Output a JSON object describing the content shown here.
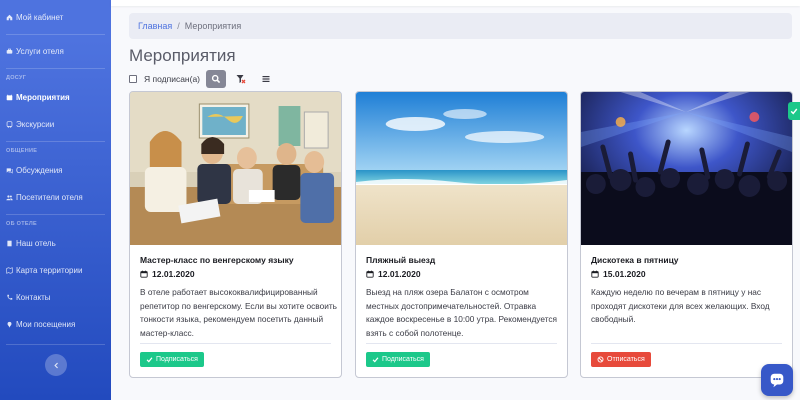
{
  "sidebar": {
    "items": [
      {
        "label": "Мой кабинет",
        "icon": "home-icon"
      },
      {
        "label": "Услуги отеля",
        "icon": "services-icon"
      },
      {
        "label": "Мероприятия",
        "icon": "calendar-icon",
        "active": true
      },
      {
        "label": "Экскурсии",
        "icon": "bus-icon"
      },
      {
        "label": "Обсуждения",
        "icon": "comments-icon"
      },
      {
        "label": "Посетители отеля",
        "icon": "users-icon"
      },
      {
        "label": "Наш отель",
        "icon": "building-icon"
      },
      {
        "label": "Карта территории",
        "icon": "map-icon"
      },
      {
        "label": "Контакты",
        "icon": "phone-icon"
      },
      {
        "label": "Мои посещения",
        "icon": "pin-icon"
      }
    ],
    "headings": [
      "ДОСУГ",
      "ОБЩЕНИЕ",
      "ОБ ОТЕЛЕ"
    ],
    "toggle_icon": "chevron-left-icon"
  },
  "breadcrumb": {
    "home": "Главная",
    "separator": "/",
    "current": "Мероприятия"
  },
  "page": {
    "title": "Мероприятия"
  },
  "filters": {
    "subscribed_label": "Я подписан(а)",
    "subscribed_checked": false
  },
  "cards": [
    {
      "title": "Мастер-класс по венгерскому языку",
      "date": "12.01.2020",
      "description": "В отеле работает высококвалифицированный репетитор по венгерскому. Если вы хотите освоить тонкости языка, рекомендуем посетить данный мастер-класс.",
      "button": "Подписаться",
      "button_state": "subscribe"
    },
    {
      "title": "Пляжный выезд",
      "date": "12.01.2020",
      "description": "Выезд на пляж озера Балатон с осмотром местных достопримечательностей. Отравка каждое воскресенье в 10:00 утра. Рекомендуется взять с собой полотенце.",
      "button": "Подписаться",
      "button_state": "subscribe"
    },
    {
      "title": "Дискотека в пятницу",
      "date": "15.01.2020",
      "description": "Каждую неделю по вечерам в пятницу у нас проходят дискотеки для всех желающих. Вход свободный.",
      "button": "Отписаться",
      "button_state": "unsubscribe"
    }
  ],
  "colors": {
    "sidebar": "#4e73df",
    "subscribe": "#1cc88a",
    "unsubscribe": "#e74a3b",
    "link": "#4e73df"
  }
}
